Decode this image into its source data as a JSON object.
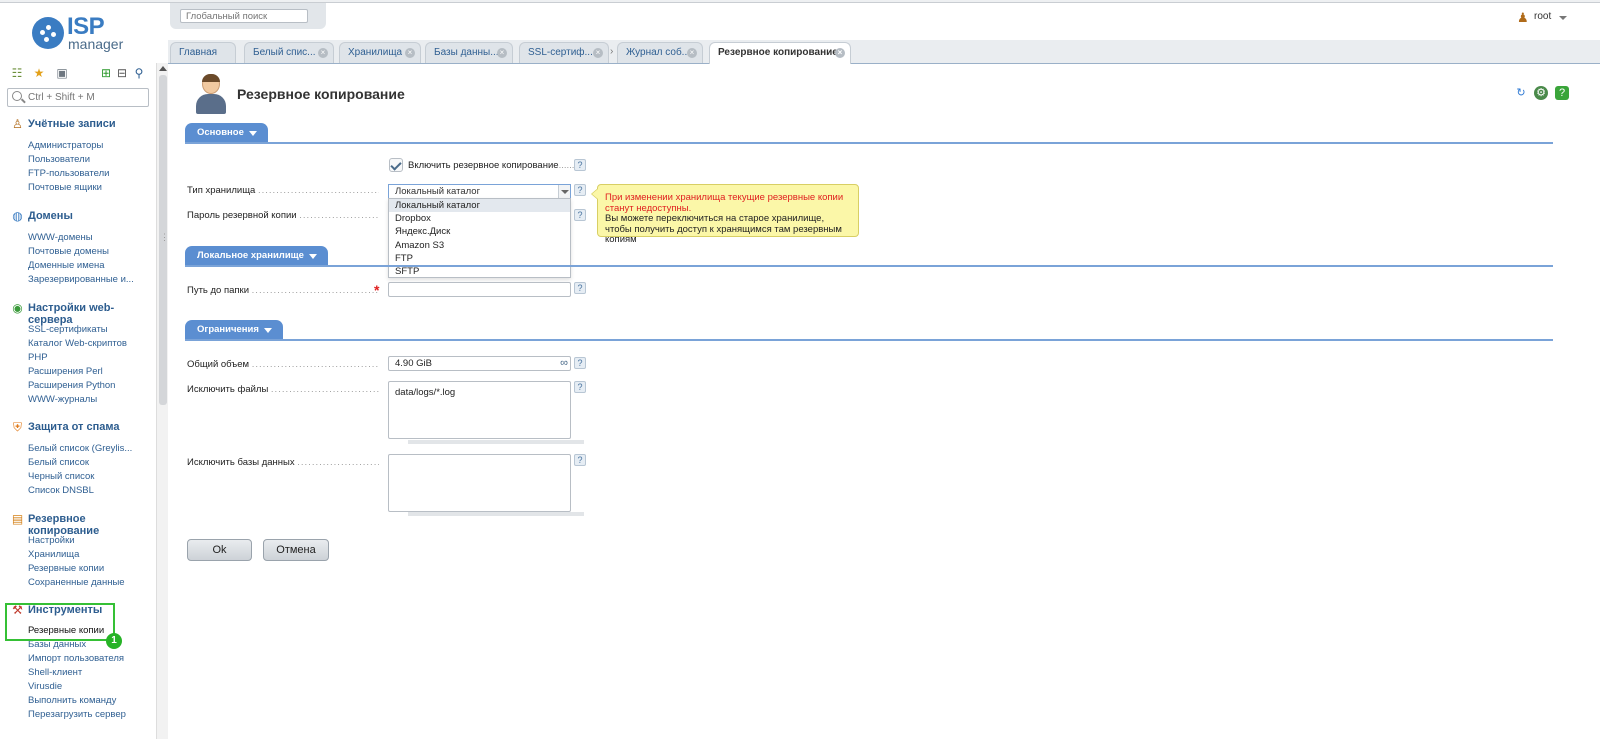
{
  "app": {
    "logo_primary": "ISP",
    "logo_secondary": "manager"
  },
  "sidebar": {
    "search_placeholder": "Ctrl + Shift + M",
    "toolbar_icons": [
      "tree-icon",
      "star-icon",
      "briefcase-icon",
      "expand-icon",
      "collapse-icon",
      "pin-icon"
    ],
    "groups": [
      {
        "title": "Учётные записи",
        "icon": "user-accounts-icon",
        "items": [
          "Администраторы",
          "Пользователи",
          "FTP-пользователи",
          "Почтовые ящики"
        ]
      },
      {
        "title": "Домены",
        "icon": "globe-icon",
        "items": [
          "WWW-домены",
          "Почтовые домены",
          "Доменные имена",
          "Зарезервированные и..."
        ]
      },
      {
        "title": "Настройки web-сервера",
        "icon": "web-server-icon",
        "items": [
          "SSL-сертификаты",
          "Каталог Web-скриптов",
          "PHP",
          "Расширения Perl",
          "Расширения Python",
          "WWW-журналы"
        ]
      },
      {
        "title": "Защита от спама",
        "icon": "shield-icon",
        "items": [
          "Белый список (Greylis...",
          "Белый список",
          "Черный список",
          "Список DNSBL"
        ]
      },
      {
        "title": "Резервное копирование",
        "icon": "backup-icon",
        "items": [
          "Настройки",
          "Хранилища",
          "Резервные копии",
          "Сохраненные данные"
        ]
      },
      {
        "title": "Инструменты",
        "icon": "tools-icon",
        "items": [
          "Резервные копии",
          "Базы данных",
          "Импорт пользователя",
          "Shell-клиент",
          "Virusdie",
          "Выполнить команду",
          "Перезагрузить сервер"
        ]
      }
    ],
    "highlight_badge": "1"
  },
  "header": {
    "global_search_placeholder": "Глобальный поиск",
    "user": "root"
  },
  "tabs": [
    {
      "label": "Главная"
    },
    {
      "label": "Белый спис..."
    },
    {
      "label": "Хранилища"
    },
    {
      "label": "Базы данны..."
    },
    {
      "label": "SSL-сертиф..."
    },
    {
      "label": "Журнал соб..."
    },
    {
      "label": "Резервное копирование"
    }
  ],
  "page": {
    "title": "Резервное копирование",
    "toolbar_icons": [
      "refresh-icon",
      "settings-icon",
      "help-icon"
    ],
    "sections": {
      "basic": "Основное",
      "local_storage": "Локальное хранилище",
      "limits": "Ограничения"
    },
    "form": {
      "enable_label": "Включить резервное копирование",
      "enable_checked": true,
      "storage_type_label": "Тип хранилища",
      "storage_type_value": "Локальный каталог",
      "storage_options": [
        "Локальный каталог",
        "Dropbox",
        "Яндекс.Диск",
        "Amazon S3",
        "FTP",
        "SFTP"
      ],
      "password_label": "Пароль резервной копии",
      "folder_path_label": "Путь до папки",
      "folder_path_value": "",
      "total_size_label": "Общий объем",
      "total_size_value": "4.90 GiB",
      "exclude_files_label": "Исключить файлы",
      "exclude_files_value": "data/logs/*.log",
      "exclude_db_label": "Исключить базы данных",
      "exclude_db_value": ""
    },
    "tooltip": {
      "warning": "При изменении хранилища текущие резервные копии станут недоступны.",
      "info": "Вы можете переключиться на старое хранилище, чтобы получить доступ к хранящимся там резервным копиям"
    },
    "buttons": {
      "ok": "Ok",
      "cancel": "Отмена"
    }
  },
  "colors": {
    "accent": "#5b8ed1",
    "link": "#2f5f92",
    "highlight_box": "#35c035",
    "tooltip_bg": "#fbf7a8",
    "required": "#e02020"
  }
}
